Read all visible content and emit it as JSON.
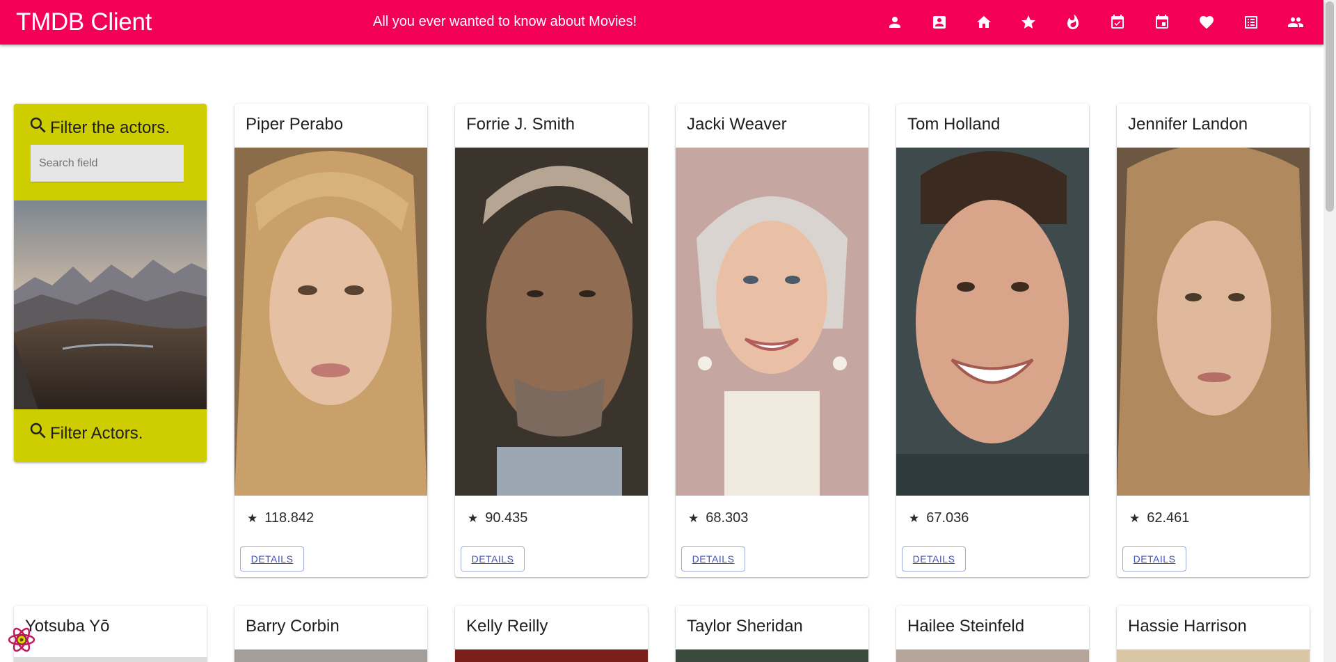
{
  "app": {
    "title": "TMDB Client",
    "tagline": "All you ever wanted to know about Movies!",
    "brand_color": "#f50057"
  },
  "nav": {
    "icons": [
      "person-icon",
      "contact-card-icon",
      "home-icon",
      "star-icon",
      "whatshot-flame-icon",
      "event-available-icon",
      "event-icon",
      "favorite-heart-icon",
      "list-alt-icon",
      "people-icon"
    ]
  },
  "filter": {
    "title": "Filter the actors.",
    "search_placeholder": "Search field",
    "footer": "Filter Actors.",
    "panel_color": "#cdcd00"
  },
  "actors": [
    {
      "name": "Piper Perabo",
      "popularity": "118.842",
      "button": "DETAILS"
    },
    {
      "name": "Forrie J. Smith",
      "popularity": "90.435",
      "button": "DETAILS"
    },
    {
      "name": "Jacki Weaver",
      "popularity": "68.303",
      "button": "DETAILS"
    },
    {
      "name": "Tom Holland",
      "popularity": "67.036",
      "button": "DETAILS"
    },
    {
      "name": "Jennifer Landon",
      "popularity": "62.461",
      "button": "DETAILS"
    }
  ],
  "second_row": [
    {
      "name": "Yotsuba Yō"
    },
    {
      "name": "Barry Corbin"
    },
    {
      "name": "Kelly Reilly"
    },
    {
      "name": "Taylor Sheridan"
    },
    {
      "name": "Hailee Steinfeld"
    },
    {
      "name": "Hassie Harrison"
    }
  ],
  "star_glyph": "★"
}
